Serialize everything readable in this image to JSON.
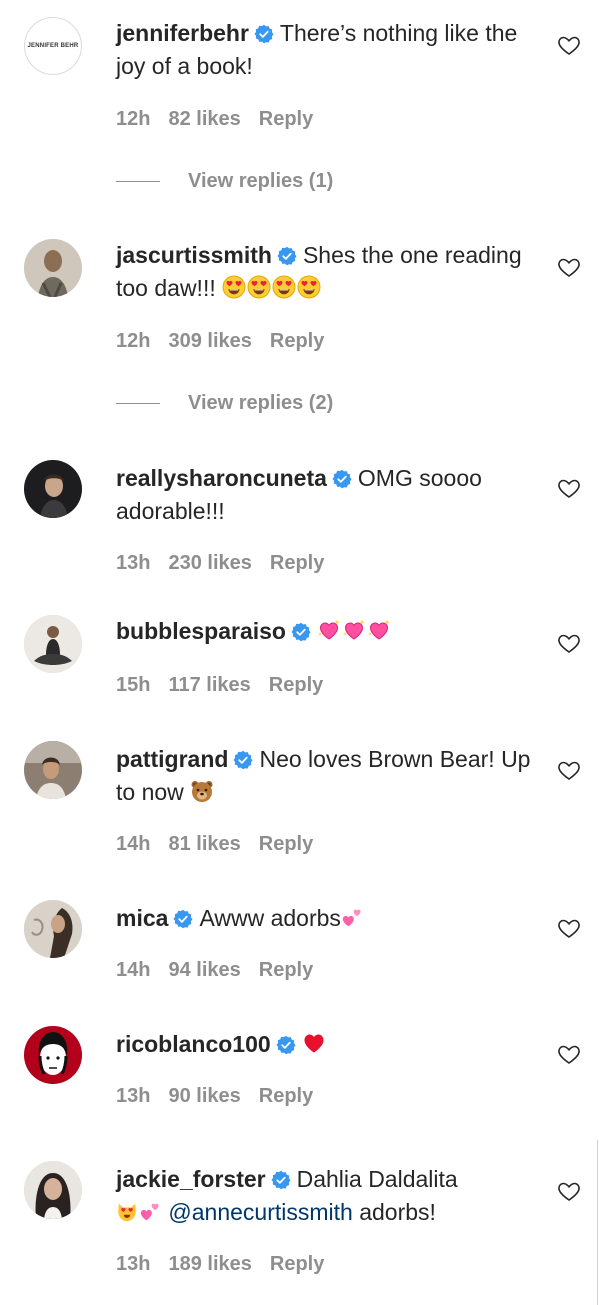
{
  "comments": [
    {
      "username": "jenniferbehr",
      "text": "There’s nothing like the joy of a book!",
      "time": "12h",
      "likes": "82 likes",
      "reply": "Reply",
      "avatar_logo": "JENNIFER BEHR",
      "view_replies": "View replies (1)",
      "avatar_color": "#ffffff"
    },
    {
      "username": "jascurtissmith",
      "text": "Shes the one reading too daw!!!",
      "emojis": [
        "smiling-face-heart-eyes",
        "smiling-face-heart-eyes",
        "smiling-face-heart-eyes",
        "smiling-face-heart-eyes"
      ],
      "time": "12h",
      "likes": "309 likes",
      "reply": "Reply",
      "view_replies": "View replies (2)",
      "avatar_color": "#a89a86"
    },
    {
      "username": "reallysharoncuneta",
      "text": "OMG soooo adorable!!!",
      "time": "13h",
      "likes": "230 likes",
      "reply": "Reply",
      "avatar_color": "#2a2a2a"
    },
    {
      "username": "bubblesparaiso",
      "text": "",
      "emojis": [
        "sparkling-heart",
        "sparkling-heart",
        "sparkling-heart"
      ],
      "time": "15h",
      "likes": "117 likes",
      "reply": "Reply",
      "avatar_color": "#e6e1dc"
    },
    {
      "username": "pattigrand",
      "text": "Neo loves Brown Bear! Up to now",
      "emojis": [
        "bear-face"
      ],
      "time": "14h",
      "likes": "81 likes",
      "reply": "Reply",
      "avatar_color": "#7c6f62"
    },
    {
      "username": "mica",
      "text": "Awww adorbs",
      "emojis": [
        "two-hearts"
      ],
      "time": "14h",
      "likes": "94 likes",
      "reply": "Reply",
      "avatar_color": "#c9c2b8"
    },
    {
      "username": "ricoblanco100",
      "text": "",
      "emojis": [
        "red-heart"
      ],
      "time": "13h",
      "likes": "90 likes",
      "reply": "Reply",
      "avatar_color": "#b3001b"
    },
    {
      "username": "jackie_forster",
      "text": "Dahlia Daldalita",
      "mention": "@annecurtissmith",
      "text_after": "adorbs!",
      "emojis": [
        "smiling-cat-heart-eyes",
        "two-hearts"
      ],
      "time": "13h",
      "likes": "189 likes",
      "reply": "Reply",
      "avatar_color": "#3a3432"
    }
  ],
  "icons": {
    "verified": "verified-badge-icon",
    "like": "heart-outline-icon"
  },
  "colors": {
    "text": "#262626",
    "meta": "#8e8e8e",
    "verified": "#3897f0",
    "mention": "#00376b"
  }
}
